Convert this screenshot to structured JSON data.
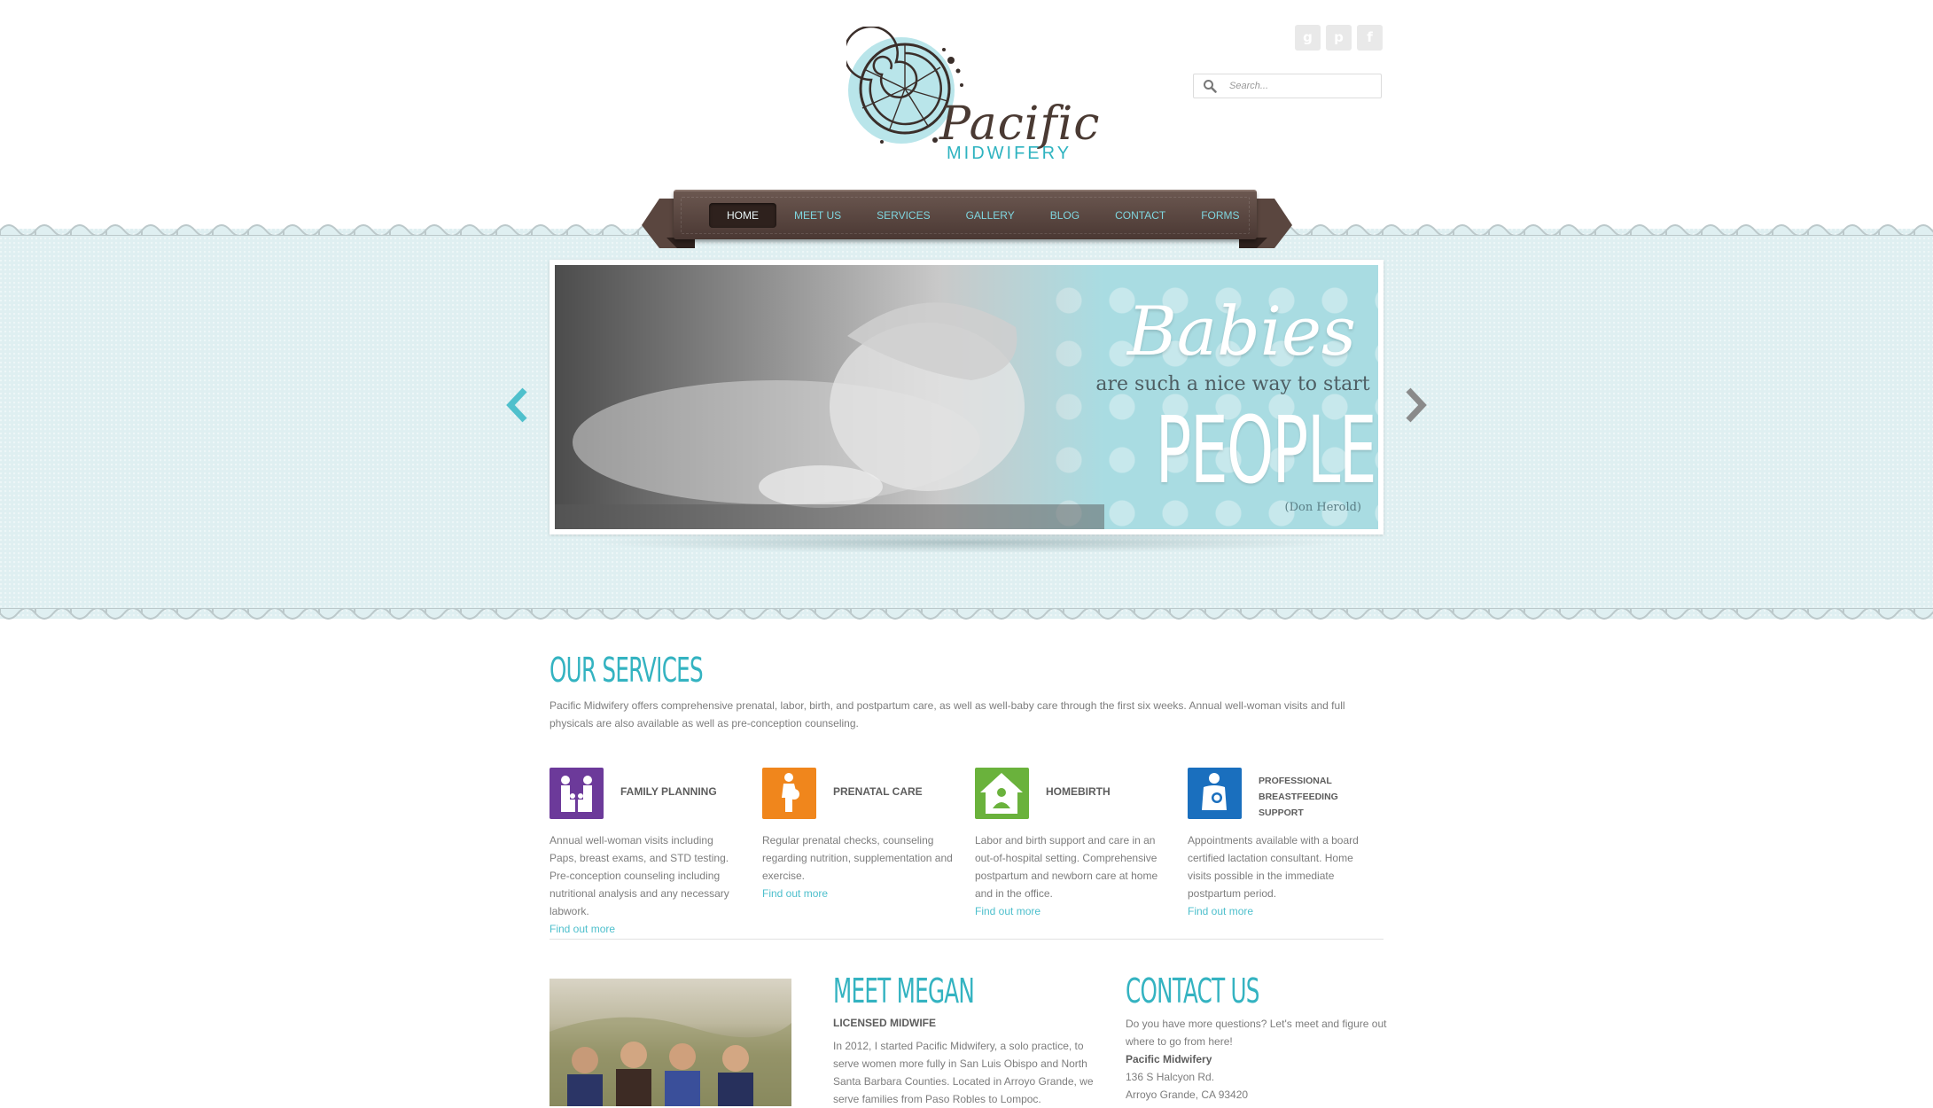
{
  "brand": {
    "name_line1": "Pacific",
    "name_line2": "MIDWIFERY",
    "colors": {
      "teal": "#34b3c1",
      "brown": "#4a3833",
      "band": "#dfeff1"
    }
  },
  "social": [
    {
      "icon": "google-plus-icon",
      "glyph": "g"
    },
    {
      "icon": "pinterest-icon",
      "glyph": "p"
    },
    {
      "icon": "facebook-icon",
      "glyph": "f"
    }
  ],
  "search": {
    "placeholder": "Search..."
  },
  "nav": {
    "items": [
      {
        "label": "HOME",
        "active": true
      },
      {
        "label": "MEET US"
      },
      {
        "label": "SERVICES"
      },
      {
        "label": "GALLERY"
      },
      {
        "label": "BLOG"
      },
      {
        "label": "CONTACT"
      },
      {
        "label": "FORMS"
      }
    ]
  },
  "slider": {
    "line1": "Babies",
    "line2": "are such a nice way to start",
    "line3": "PEOPLE.",
    "attribution": "(Don Herold)"
  },
  "services": {
    "title": "OUR SERVICES",
    "intro": "Pacific Midwifery offers comprehensive prenatal, labor, birth, and postpartum care, as well as well-baby care through the first six weeks. Annual well-woman visits and full physicals are also available as well as pre-conception counseling.",
    "items": [
      {
        "title": "FAMILY PLANNING",
        "color": "#6c3a9a",
        "text": "Annual well-woman visits including Paps, breast exams, and STD testing. Pre-conception counseling including nutritional analysis and any necessary labwork.",
        "link": "Find out more"
      },
      {
        "title": "PRENATAL CARE",
        "color": "#f0861c",
        "text": "Regular prenatal checks, counseling regarding nutrition, supplementation and exercise.",
        "link": "Find out more"
      },
      {
        "title": "HOMEBIRTH",
        "color": "#6ab23c",
        "text": "Labor and birth support and care in an out-of-hospital setting. Comprehensive postpartum and newborn care at home and in the office.",
        "link": "Find out more"
      },
      {
        "title": "PROFESSIONAL BREASTFEEDING SUPPORT",
        "color": "#1a6fbe",
        "text": "Appointments available with a board certified lactation consultant. Home visits possible in the immediate postpartum period.",
        "link": "Find out more"
      }
    ]
  },
  "meet": {
    "title": "MEET MEGAN",
    "subtitle": "LICENSED MIDWIFE",
    "text": "In 2012, I started Pacific Midwifery, a solo practice, to serve women more fully in San Luis Obispo and North Santa Barbara Counties.  Located in Arroyo Grande, we serve families from Paso Robles to Lompoc."
  },
  "contact": {
    "title": "CONTACT US",
    "intro": "Do you have more questions? Let's meet and figure out where to go from here!",
    "name": "Pacific Midwifery",
    "address1": "136 S Halcyon Rd.",
    "address2": "Arroyo Grande, CA 93420"
  }
}
